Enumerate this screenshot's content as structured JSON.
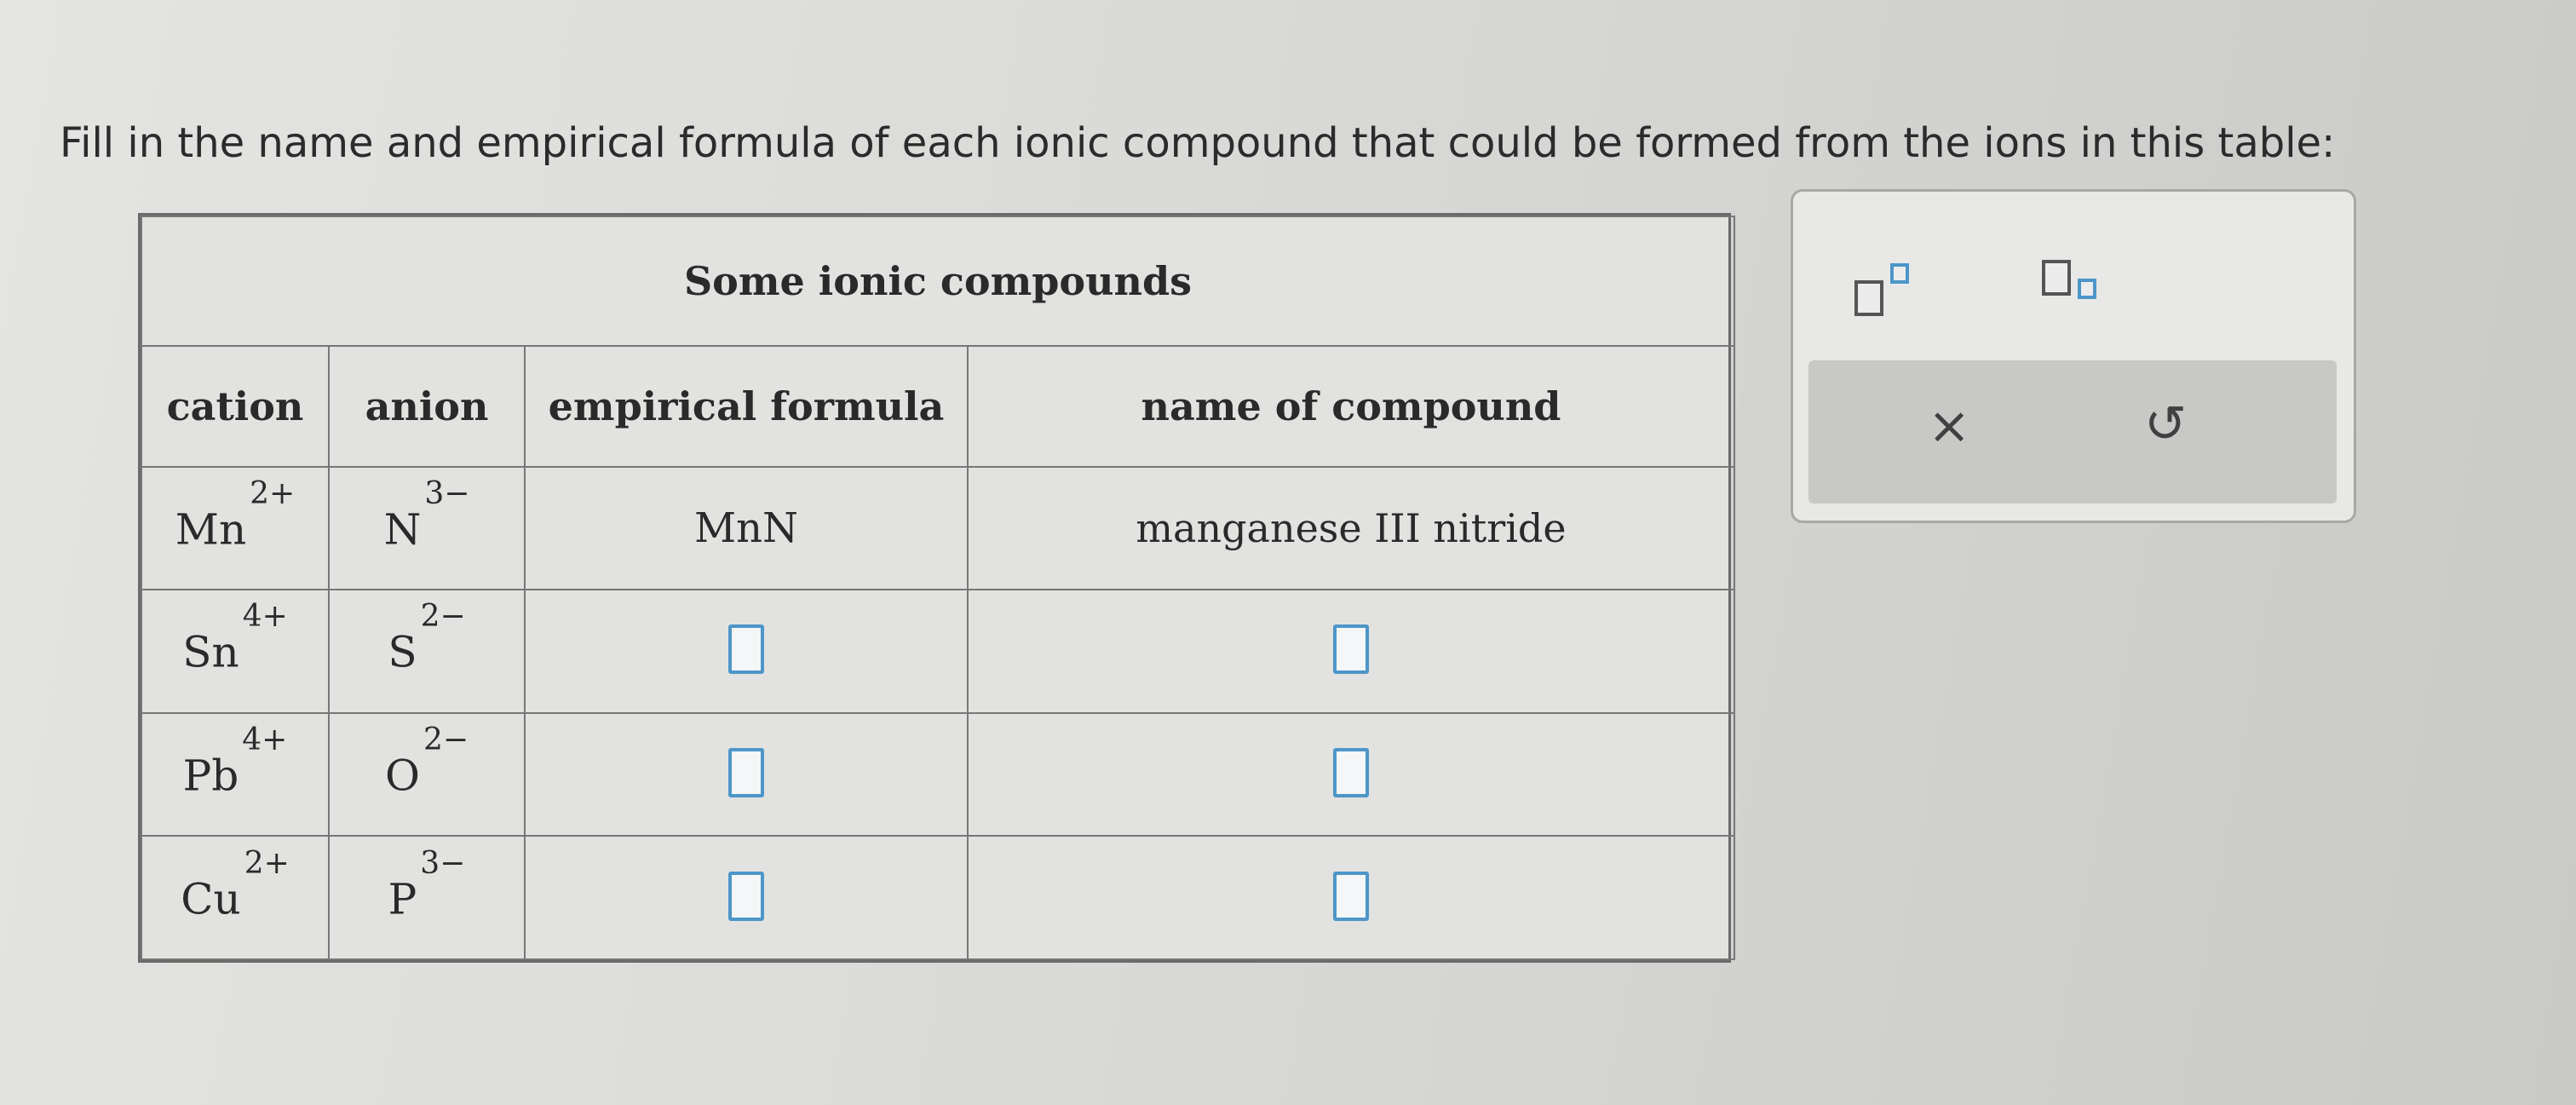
{
  "prompt": "Fill in the name and empirical formula of each ionic compound that could be formed from the ions in this table:",
  "table": {
    "title": "Some ionic compounds",
    "headers": {
      "cation": "cation",
      "anion": "anion",
      "formula": "empirical formula",
      "name": "name of compound"
    },
    "rows": [
      {
        "cation": "Mn",
        "cation_charge": "2+",
        "anion": "N",
        "anion_charge": "3−",
        "formula": "MnN",
        "name": "manganese III nitride"
      },
      {
        "cation": "Sn",
        "cation_charge": "4+",
        "anion": "S",
        "anion_charge": "2−",
        "formula": "",
        "name": ""
      },
      {
        "cation": "Pb",
        "cation_charge": "4+",
        "anion": "O",
        "anion_charge": "2−",
        "formula": "",
        "name": ""
      },
      {
        "cation": "Cu",
        "cation_charge": "2+",
        "anion": "P",
        "anion_charge": "3−",
        "formula": "",
        "name": ""
      }
    ]
  },
  "toolbar": {
    "superscript_icon": "superscript-template-icon",
    "subscript_icon": "subscript-template-icon",
    "clear_icon": "×",
    "undo_icon": "↺"
  }
}
